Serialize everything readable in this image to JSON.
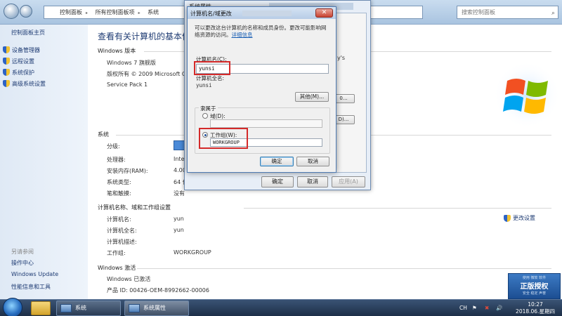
{
  "control_panel": {
    "breadcrumbs": [
      "控制面板",
      "所有控制面板项",
      "系统"
    ],
    "search_placeholder": "搜索控制面板",
    "sidebar": {
      "home": "控制面板主页",
      "links": [
        "设备管理器",
        "远程设置",
        "系统保护",
        "高级系统设置"
      ],
      "see_also_label": "另请参阅",
      "bottom_links": [
        "操作中心",
        "Windows Update",
        "性能信息和工具"
      ]
    },
    "main": {
      "title": "查看有关计算机的基本信息",
      "edition_heading": "Windows 版本",
      "edition": "Windows 7 旗舰版",
      "copyright": "版权所有 © 2009 Microsoft Co",
      "service_pack": "Service Pack 1",
      "system_heading": "系统",
      "rows": [
        {
          "label": "分级:",
          "value": ""
        },
        {
          "label": "处理器:",
          "value": "Inte"
        },
        {
          "label": "安装内存(RAM):",
          "value": "4.00"
        },
        {
          "label": "系统类型:",
          "value": "64 位"
        },
        {
          "label": "笔和触摸:",
          "value": "没有"
        }
      ],
      "computer_heading": "计算机名称、域和工作组设置",
      "computer_rows": [
        {
          "label": "计算机名:",
          "value": "yun"
        },
        {
          "label": "计算机全名:",
          "value": "yun"
        },
        {
          "label": "计算机描述:",
          "value": ""
        },
        {
          "label": "工作组:",
          "value": "WORKGROUP"
        }
      ],
      "change_settings": "更改设置",
      "activation_heading": "Windows 激活",
      "activation_status": "Windows 已激活",
      "product_id": "产品 ID: 00426-OEM-8992662-00006",
      "genuine_badge": {
        "top": "使用 微软 软件",
        "main": "正版授权",
        "bottom": "安全 稳定 声誉"
      }
    }
  },
  "system_properties": {
    "title": "系统属性",
    "stray_text": "y's",
    "side_buttons": [
      "D)...",
      "0..."
    ],
    "buttons": {
      "ok": "确定",
      "cancel": "取消",
      "apply": "应用(A)"
    }
  },
  "dialog": {
    "title": "计算机名/域更改",
    "description": "可以更改这台计算机的名称和成员身份。更改可能影响网络资源的访问。",
    "details_link": "详细信息",
    "computer_name_label": "计算机名(C):",
    "computer_name_value": "yunsi",
    "full_name_label": "计算机全名:",
    "full_name_value": "yunsi",
    "other_button": "其他(M)...",
    "member_of_label": "隶属于",
    "domain_label": "域(D):",
    "domain_value": "",
    "workgroup_label": "工作组(W):",
    "workgroup_value": "WORKGROUP",
    "selected": "workgroup",
    "ok": "确定",
    "cancel": "取消"
  },
  "taskbar": {
    "apps": [
      {
        "label": "系统",
        "active": false
      },
      {
        "label": "系统属性",
        "active": true
      }
    ],
    "tray": {
      "lang": "CH",
      "time": "10:27",
      "date": "2018.06.星期四"
    }
  },
  "colors": {
    "link": "#1e3b73",
    "highlight": "#d42a2a",
    "accent": "#1a5fb4"
  }
}
